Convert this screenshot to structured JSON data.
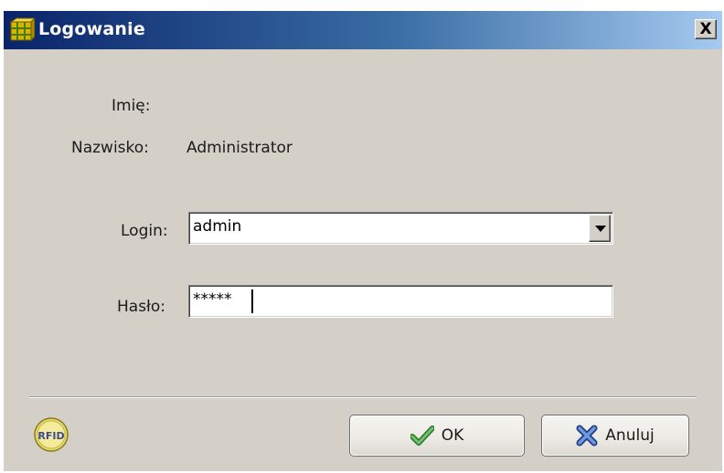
{
  "window": {
    "title": "Logowanie",
    "close_label": "X"
  },
  "form": {
    "first_name_label": "Imię:",
    "first_name_value": "",
    "last_name_label": "Nazwisko:",
    "last_name_value": "Administrator",
    "login_label": "Login:",
    "login_value": "admin",
    "password_label": "Hasło:",
    "password_value": "*****"
  },
  "footer": {
    "rfid_label": "RFID",
    "ok_label": "OK",
    "cancel_label": "Anuluj"
  },
  "icons": {
    "app": "grid-cube-icon",
    "ok": "check-icon",
    "cancel": "x-icon",
    "rfid": "rfid-icon"
  },
  "colors": {
    "titlebar_start": "#0a246a",
    "titlebar_end": "#a6caf0",
    "dialog_bg": "#d4d0c8",
    "check_green": "#3a9a3a",
    "cancel_blue": "#3a5fb0"
  }
}
